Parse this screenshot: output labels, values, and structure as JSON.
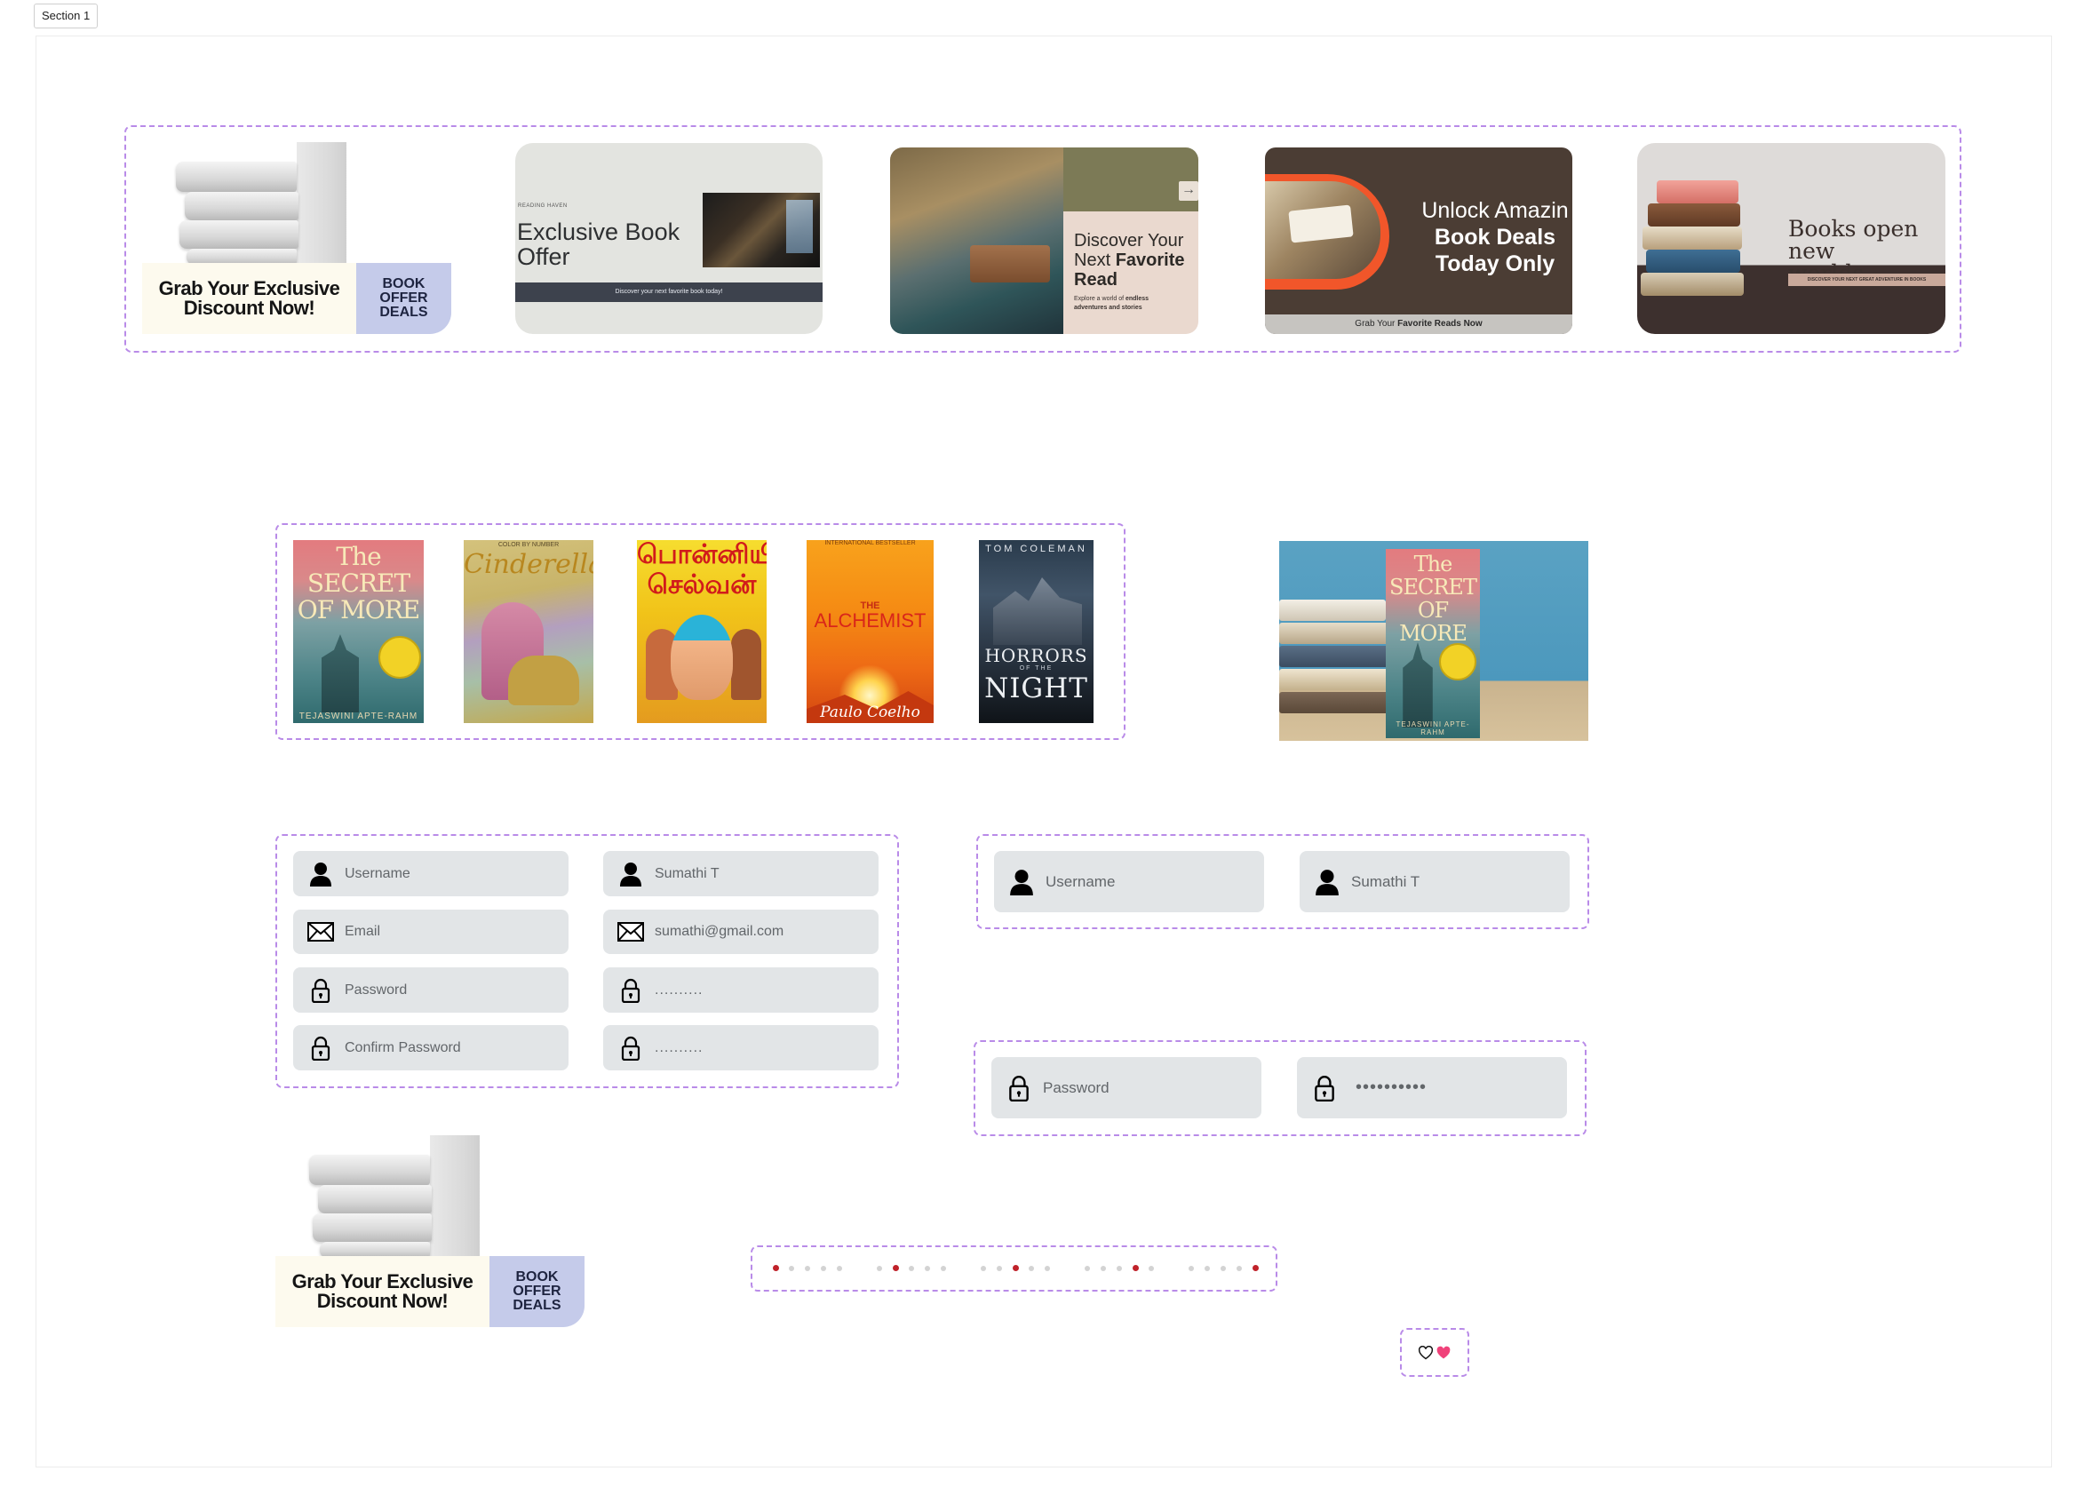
{
  "canvas": {
    "section_label": "Section 1"
  },
  "banners": {
    "promo_1": {
      "line1": "Grab Your Exclusive",
      "line2": "Discount Now!",
      "badge_1": "BOOK",
      "badge_2": "OFFER",
      "badge_3": "DEALS"
    },
    "promo_2": {
      "eyebrow": "READING HAVEN",
      "title_1": "Exclusive Book",
      "title_2": "Offer",
      "strip": "Discover your next favorite book today!"
    },
    "promo_3": {
      "line1": "Discover Your",
      "line2_a": "Next ",
      "line2_b": "Favorite",
      "line3": "Read",
      "sub_a": "Explore a world of ",
      "sub_b": "endless",
      "sub_c": "adventures and stories",
      "arrow": "→"
    },
    "promo_4": {
      "line1": "Unlock Amazin",
      "line2": "Book Deals",
      "line3": "Today Only",
      "bar_a": "Grab Your ",
      "bar_b": "Favorite Reads Now"
    },
    "promo_5": {
      "title_1": "Books open new",
      "title_2": "worlds",
      "tag": "DISCOVER YOUR NEXT GREAT ADVENTURE IN BOOKS"
    }
  },
  "covers": [
    {
      "title_1": "The",
      "title_2": "SECRET",
      "title_3": "OF MORE",
      "author": "TEJASWINI APTE-RAHM"
    },
    {
      "top": "COLOR BY NUMBER",
      "title": "Cinderella"
    },
    {
      "title_1": "பொன்னியின்",
      "title_2": "செல்வன்"
    },
    {
      "top": "INTERNATIONAL BESTSELLER",
      "the": "THE",
      "title": "ALCHEMIST",
      "author": "Paulo Coelho"
    },
    {
      "author": "TOM COLEMAN",
      "title_1": "HORRORS",
      "of": "OF THE",
      "title_2": "NIGHT"
    }
  ],
  "mockup": {
    "title_1": "The",
    "title_2": "SECRET",
    "title_3": "OF MORE",
    "author": "TEJASWINI APTE-RAHM"
  },
  "form": {
    "username_placeholder": "Username",
    "username_value": "Sumathi T",
    "email_placeholder": "Email",
    "email_value": "sumathi@gmail.com",
    "password_placeholder": "Password",
    "password_masked": "..........",
    "confirm_placeholder": "Confirm Password",
    "confirm_masked": "..........",
    "password_masked_large": "••••••••••"
  },
  "promo_small": {
    "line1": "Grab Your Exclusive",
    "line2": "Discount Now!",
    "badge_1": "BOOK",
    "badge_2": "OFFER",
    "badge_3": "DEALS"
  },
  "pagination": {
    "groups": 5,
    "dots_per_group": 5,
    "active_index_by_group": [
      0,
      1,
      2,
      3,
      4
    ]
  },
  "heart_toggle": {
    "outline_icon": "heart-outline-icon",
    "filled_icon": "heart-filled-icon",
    "filled_color": "#f0427a"
  },
  "colors": {
    "frame_dash": "#b98be8",
    "field_bg": "#e2e5e7",
    "active_dot": "#c0222a"
  }
}
